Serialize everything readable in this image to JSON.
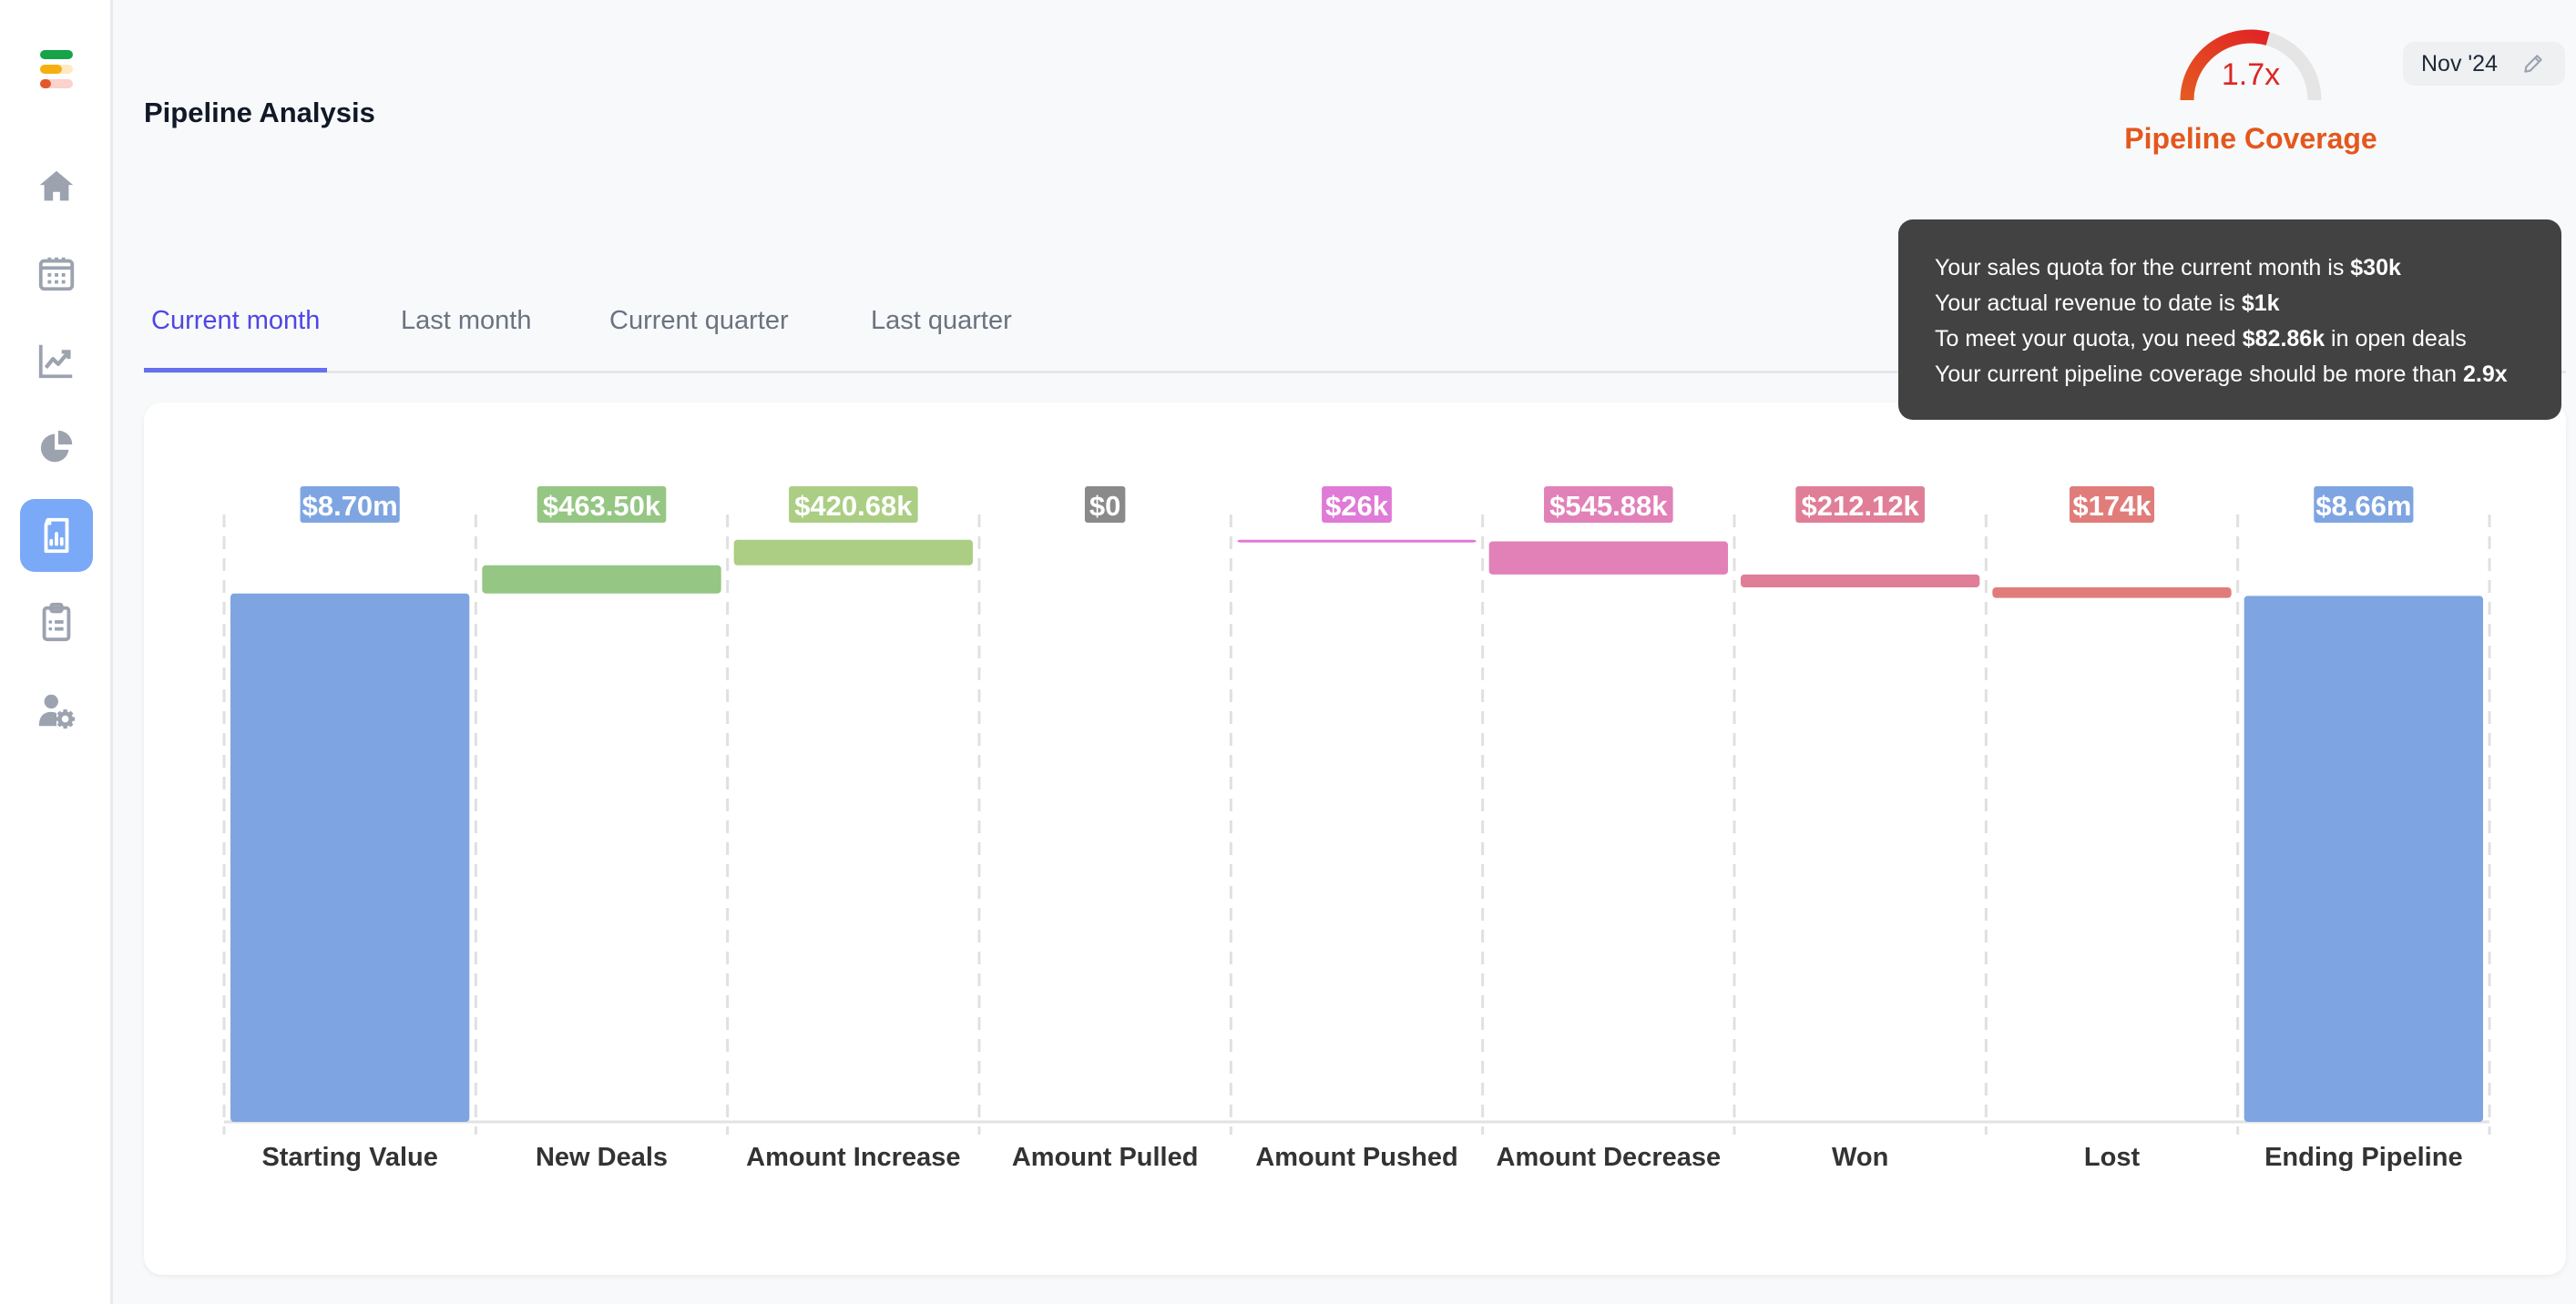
{
  "app": {
    "logo_colors": [
      "#16a34a",
      "#f5b010",
      "#e4572e"
    ]
  },
  "sidebar": {
    "items": [
      {
        "name": "home",
        "icon": "home-icon",
        "active": false
      },
      {
        "name": "calendar",
        "icon": "calendar-icon",
        "active": false
      },
      {
        "name": "trends",
        "icon": "line-chart-icon",
        "active": false
      },
      {
        "name": "breakdown",
        "icon": "pie-chart-icon",
        "active": false
      },
      {
        "name": "reports",
        "icon": "report-icon",
        "active": true
      },
      {
        "name": "tasks",
        "icon": "clipboard-list-icon",
        "active": false
      },
      {
        "name": "user-settings",
        "icon": "user-gear-icon",
        "active": false
      }
    ]
  },
  "header": {
    "title": "Pipeline Analysis",
    "date_selector": "Nov '24"
  },
  "coverage": {
    "value_label": "1.7x",
    "value": 1.7,
    "target": 2.9,
    "label": "Pipeline Coverage"
  },
  "tooltip": {
    "lines": [
      {
        "text": "Your sales quota for the current month is ",
        "bold": "$30k",
        "after": ""
      },
      {
        "text": "Your actual revenue to date is ",
        "bold": "$1k",
        "after": ""
      },
      {
        "text": "To meet your quota, you need ",
        "bold": "$82.86k",
        "after": " in open deals"
      },
      {
        "text": "Your current pipeline coverage should be more than ",
        "bold": "2.9x",
        "after": ""
      }
    ]
  },
  "tabs": [
    {
      "label": "Current month",
      "active": true
    },
    {
      "label": "Last month",
      "active": false
    },
    {
      "label": "Current quarter",
      "active": false
    },
    {
      "label": "Last quarter",
      "active": false
    }
  ],
  "chart_data": {
    "type": "bar",
    "subtype": "waterfall",
    "title": "",
    "xlabel": "",
    "ylabel": "",
    "ylim": [
      0,
      10000000
    ],
    "grid": "vertical-dashed",
    "categories": [
      "Starting Value",
      "New Deals",
      "Amount Increase",
      "Amount Pulled",
      "Amount Pushed",
      "Amount Decrease",
      "Won",
      "Lost",
      "Ending Pipeline"
    ],
    "bars": [
      {
        "category": "Starting Value",
        "kind": "total",
        "value": 8700000,
        "label": "$8.70m",
        "color": "#7ea5e1"
      },
      {
        "category": "New Deals",
        "kind": "increase",
        "value": 463500,
        "label": "$463.50k",
        "color": "#95c683"
      },
      {
        "category": "Amount Increase",
        "kind": "increase",
        "value": 420680,
        "label": "$420.68k",
        "color": "#abce84"
      },
      {
        "category": "Amount Pulled",
        "kind": "increase",
        "value": 0,
        "label": "$0",
        "color": "#8a8a8a"
      },
      {
        "category": "Amount Pushed",
        "kind": "decrease",
        "value": 26000,
        "label": "$26k",
        "color": "#df7ad6"
      },
      {
        "category": "Amount Decrease",
        "kind": "decrease",
        "value": 545880,
        "label": "$545.88k",
        "color": "#e181b8"
      },
      {
        "category": "Won",
        "kind": "decrease",
        "value": 212120,
        "label": "$212.12k",
        "color": "#e07e97"
      },
      {
        "category": "Lost",
        "kind": "decrease",
        "value": 174000,
        "label": "$174k",
        "color": "#e07d7a"
      },
      {
        "category": "Ending Pipeline",
        "kind": "total",
        "value": 8660000,
        "label": "$8.66m",
        "color": "#7ea5e1"
      }
    ]
  }
}
